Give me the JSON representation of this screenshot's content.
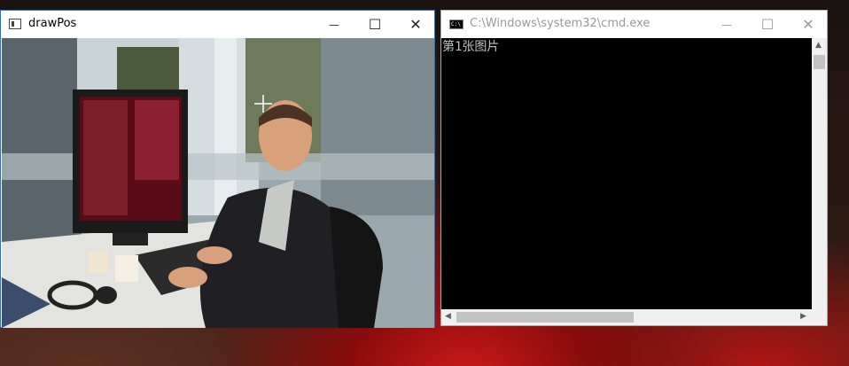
{
  "windows": {
    "drawpos": {
      "title": "drawPos",
      "controls": {
        "minimize": "—",
        "maximize": "☐",
        "close": "✕"
      }
    },
    "cmd": {
      "title": "C:\\Windows\\system32\\cmd.exe",
      "icon_text": "C:\\",
      "controls": {
        "minimize": "—",
        "maximize": "☐",
        "close": "✕"
      },
      "console_output": "第1张图片"
    }
  },
  "colors": {
    "active_border": "#1e73c8",
    "console_bg": "#000000",
    "console_text": "#c0c0c0"
  },
  "icons": [
    "app-icon",
    "cmd-icon",
    "crosshair-cursor-icon"
  ]
}
